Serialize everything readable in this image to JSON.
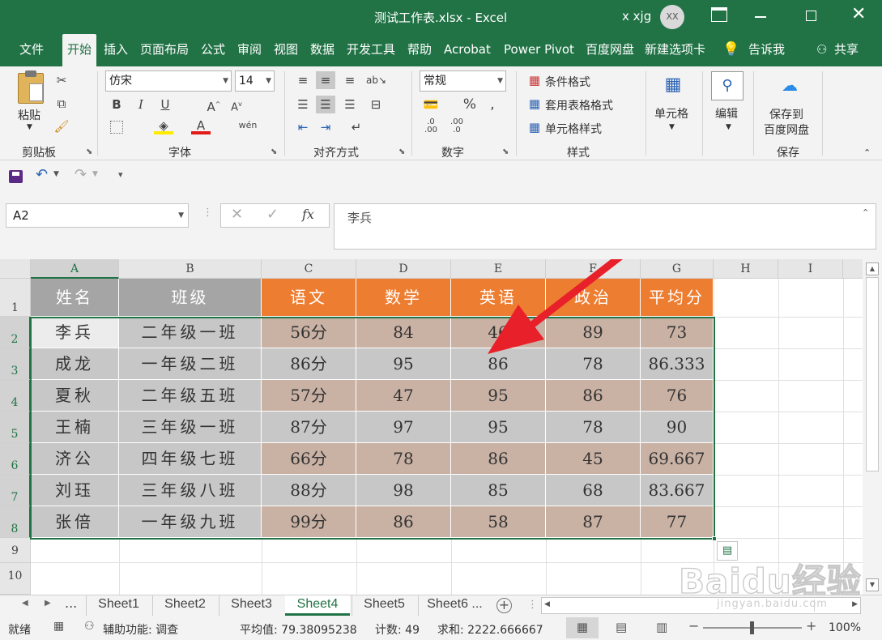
{
  "window": {
    "title": "测试工作表.xlsx  -  Excel",
    "user_name": "x xjg",
    "user_initials": "XX"
  },
  "tabs": [
    "文件",
    "开始",
    "插入",
    "页面布局",
    "公式",
    "审阅",
    "视图",
    "数据",
    "开发工具",
    "帮助",
    "Acrobat",
    "Power Pivot",
    "百度网盘",
    "新建选项卡"
  ],
  "tell_me": "告诉我",
  "share": "共享",
  "ribbon": {
    "clipboard": {
      "paste": "粘贴",
      "label": "剪贴板"
    },
    "font": {
      "name": "仿宋",
      "size": "14",
      "label": "字体"
    },
    "align": {
      "label": "对齐方式"
    },
    "number": {
      "format": "常规",
      "label": "数字"
    },
    "styles": {
      "cond": "条件格式",
      "table": "套用表格格式",
      "cell": "单元格样式",
      "label": "样式"
    },
    "cells": {
      "label": "单元格"
    },
    "edit": {
      "label": "编辑"
    },
    "save": {
      "line1": "保存到",
      "line2": "百度网盘",
      "label": "保存"
    }
  },
  "namebox": "A2",
  "formula": "李兵",
  "columns": [
    "A",
    "B",
    "C",
    "D",
    "E",
    "F",
    "G",
    "H",
    "I"
  ],
  "rows": [
    "1",
    "2",
    "3",
    "4",
    "5",
    "6",
    "7",
    "8",
    "9",
    "10"
  ],
  "table": {
    "header": [
      "姓名",
      "班级",
      "语文",
      "数学",
      "英语",
      "政治",
      "平均分"
    ],
    "rows": [
      [
        "李兵",
        "二年级一班",
        "56分",
        "84",
        "46",
        "89",
        "73"
      ],
      [
        "成龙",
        "一年级二班",
        "86分",
        "95",
        "86",
        "78",
        "86.333"
      ],
      [
        "夏秋",
        "二年级五班",
        "57分",
        "47",
        "95",
        "86",
        "76"
      ],
      [
        "王楠",
        "三年级一班",
        "87分",
        "97",
        "95",
        "78",
        "90"
      ],
      [
        "济公",
        "四年级七班",
        "66分",
        "78",
        "86",
        "45",
        "69.667"
      ],
      [
        "刘珏",
        "三年级八班",
        "88分",
        "98",
        "85",
        "68",
        "83.667"
      ],
      [
        "张倍",
        "一年级九班",
        "99分",
        "86",
        "58",
        "87",
        "77"
      ]
    ]
  },
  "colors": {
    "excel_green": "#217346",
    "header_gray": "#a5a5a5",
    "header_orange": "#ed7d31",
    "body_gray": "#c7c7c7",
    "body_tan": "#c9b1a4",
    "arrow_red": "#e8202a"
  },
  "sheets": {
    "nav_more": "...",
    "names": [
      "Sheet1",
      "Sheet2",
      "Sheet3",
      "Sheet4",
      "Sheet5",
      "Sheet6 ..."
    ],
    "active": "Sheet4"
  },
  "status": {
    "ready": "就绪",
    "accessibility": "辅助功能: 调查",
    "average": "平均值: 79.38095238",
    "count": "计数: 49",
    "sum": "求和: 2222.666667",
    "zoom": "100%"
  },
  "watermark": {
    "text": "Baidu经验",
    "url": "jingyan.baidu.com"
  }
}
